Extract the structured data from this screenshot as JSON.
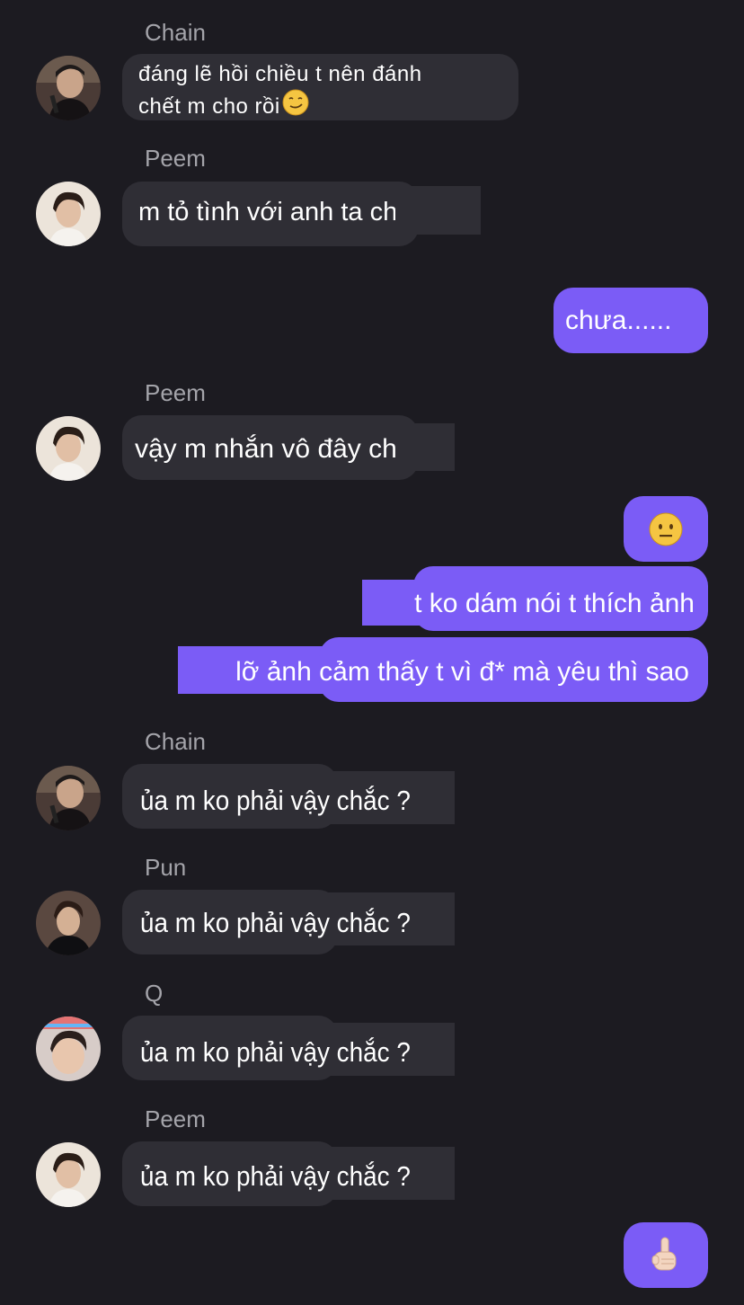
{
  "messages": [
    {
      "sender": "Chain",
      "text": "đáng lẽ hồi chiều t nên đánh chết m cho rồi",
      "emoji": "smirk-emoji",
      "line1": "đáng lẽ hồi chiều t nên đánh",
      "line2": "chết m cho rồi"
    },
    {
      "sender": "Peem",
      "text": "m tỏ tình với anh ta chưa ?"
    },
    {
      "sender": "me",
      "text": "chưa......"
    },
    {
      "sender": "Peem",
      "text": "vậy m nhắn vô đây chi"
    },
    {
      "sender": "me",
      "emoji": "neutral-face-emoji"
    },
    {
      "sender": "me",
      "text": "t ko dám nói t thích ảnh"
    },
    {
      "sender": "me",
      "text": "lỡ ảnh cảm thấy t vì đ* mà yêu thì sao"
    },
    {
      "sender": "Chain",
      "text": "ủa m ko phải vậy chắc ?"
    },
    {
      "sender": "Pun",
      "text": "ủa m ko phải vậy chắc ?"
    },
    {
      "sender": "Q",
      "text": "ủa m ko phải vậy chắc ?"
    },
    {
      "sender": "Peem",
      "text": "ủa m ko phải vậy chắc ?"
    },
    {
      "sender": "me",
      "emoji": "pointing-up-hand-emoji"
    }
  ],
  "colors": {
    "background": "#1c1b21",
    "incoming_bubble": "#2f2e35",
    "outgoing_bubble": "#7b5cf6",
    "sender_name": "#a4a4aa"
  }
}
